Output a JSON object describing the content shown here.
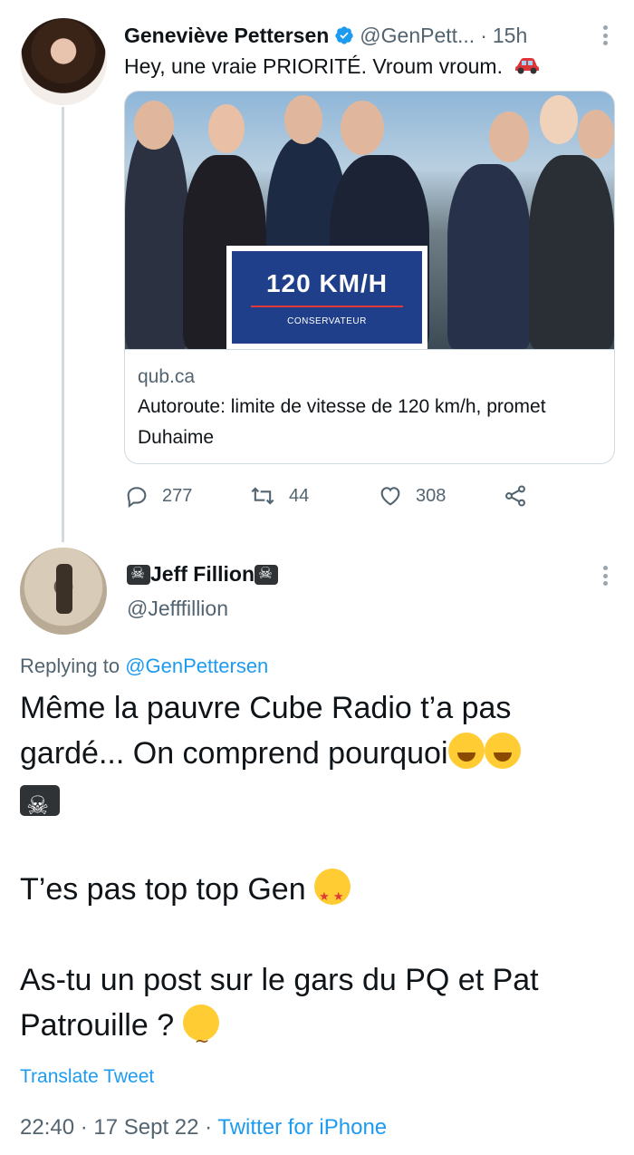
{
  "tweet1": {
    "author_name": "Geneviève Pettersen",
    "author_handle": "@GenPett...",
    "separator": "·",
    "time": "15h",
    "text": "Hey, une vraie PRIORITÉ. Vroum vroum.",
    "emoji": "car-icon",
    "card": {
      "image_sign_text": "120 KM/H",
      "image_sign_logo": "CONSERVATEUR",
      "domain": "qub.ca",
      "title": "Autoroute: limite de vitesse de 120 km/h, promet Duhaime"
    },
    "actions": {
      "replies": "277",
      "retweets": "44",
      "likes": "308"
    }
  },
  "tweet2": {
    "author_name": "Jeff Fillion",
    "author_handle": "@Jefffillion",
    "replying_prefix": "Replying to",
    "replying_to": "@GenPettersen",
    "paragraph1": "Même la pauvre Cube Radio t’a pas gardé... On comprend pourquoi",
    "paragraph2": "T’es pas top top Gen",
    "paragraph3": "As-tu un post sur le gars du PQ et Pat Patrouille ?",
    "translate_label": "Translate Tweet",
    "timestamp": "22:40 · 17 Sept 22 ·",
    "source": "Twitter for iPhone"
  },
  "colors": {
    "accent": "#1d9bf0",
    "secondary_text": "#536471",
    "primary_text": "#0f1419",
    "border": "#cfd9de"
  }
}
